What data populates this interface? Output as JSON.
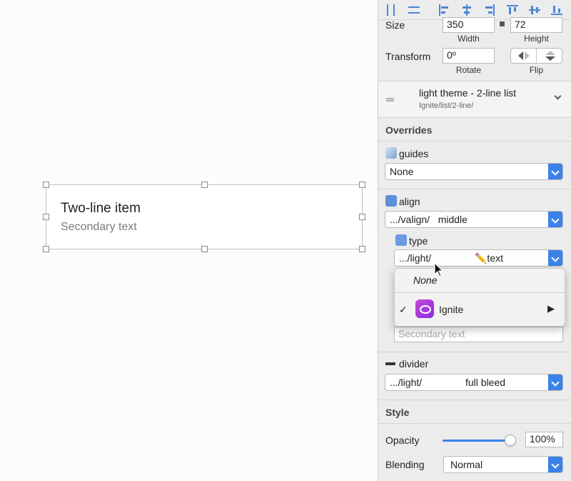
{
  "canvas": {
    "item_title": "Two-line item",
    "item_subtitle": "Secondary text"
  },
  "inspector": {
    "size": {
      "label": "Size",
      "width": "350",
      "width_label": "Width",
      "height": "72",
      "height_label": "Height"
    },
    "transform": {
      "label": "Transform",
      "rotate": "0º",
      "rotate_label": "Rotate",
      "flip_label": "Flip"
    },
    "symbol": {
      "name": "light theme - 2-line list",
      "path": "Ignite/list/2-line/"
    },
    "overrides": {
      "title": "Overrides",
      "guides": {
        "label": "guides",
        "value": "None"
      },
      "align": {
        "label": "align",
        "value": ".../valign/   middle"
      },
      "type": {
        "label": "type",
        "value_left": ".../light/",
        "value_right": "✏️text"
      },
      "secondary_placeholder": "Secondary text",
      "divider": {
        "label": "divider",
        "value_left": ".../light/",
        "value_right": "full bleed"
      }
    },
    "style": {
      "title": "Style",
      "opacity_label": "Opacity",
      "opacity_value": "100%",
      "opacity_fraction": 0.95,
      "blending_label": "Blending",
      "blending_value": "Normal"
    },
    "accent": "#3b82e8"
  },
  "popup": {
    "none_label": "None",
    "check": "✓",
    "ignite_label": "Ignite",
    "submenu_arrow": "▶"
  }
}
